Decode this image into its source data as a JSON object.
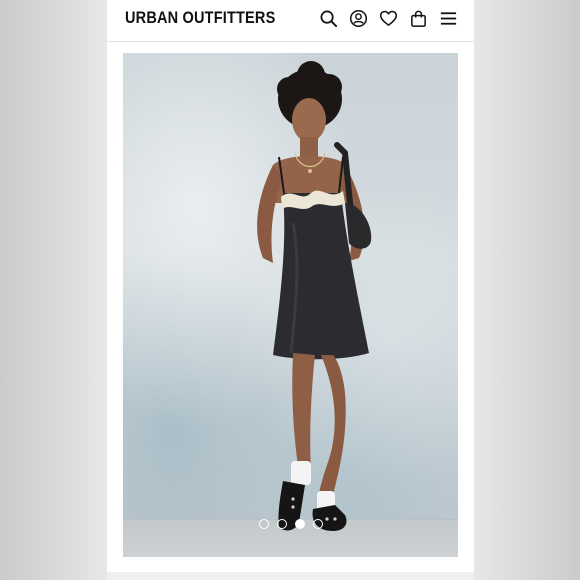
{
  "header": {
    "logo": "URBAN OUTFITTERS",
    "icons": [
      "search-icon",
      "account-icon",
      "wishlist-icon",
      "bag-icon",
      "menu-icon"
    ]
  },
  "gallery": {
    "image_subject": "model-in-black-satin-lace-trim-slip-dress",
    "slide_count": 4,
    "active_slide": 3
  },
  "colors": {
    "header_bg": "#ffffff",
    "logo": "#111111",
    "dot": "#ffffff",
    "wall": "#cdd6db"
  }
}
